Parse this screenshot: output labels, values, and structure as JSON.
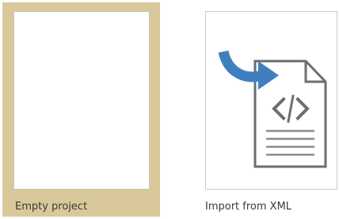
{
  "templates": [
    {
      "label": "Empty project",
      "selected": true,
      "icon": "blank-page-icon"
    },
    {
      "label": "Import from XML",
      "selected": false,
      "icon": "import-xml-icon"
    }
  ],
  "colors": {
    "selected_tile_background": "#d9c99a",
    "import_arrow": "#3f7fbf",
    "document_outline": "#6e6e6e"
  }
}
